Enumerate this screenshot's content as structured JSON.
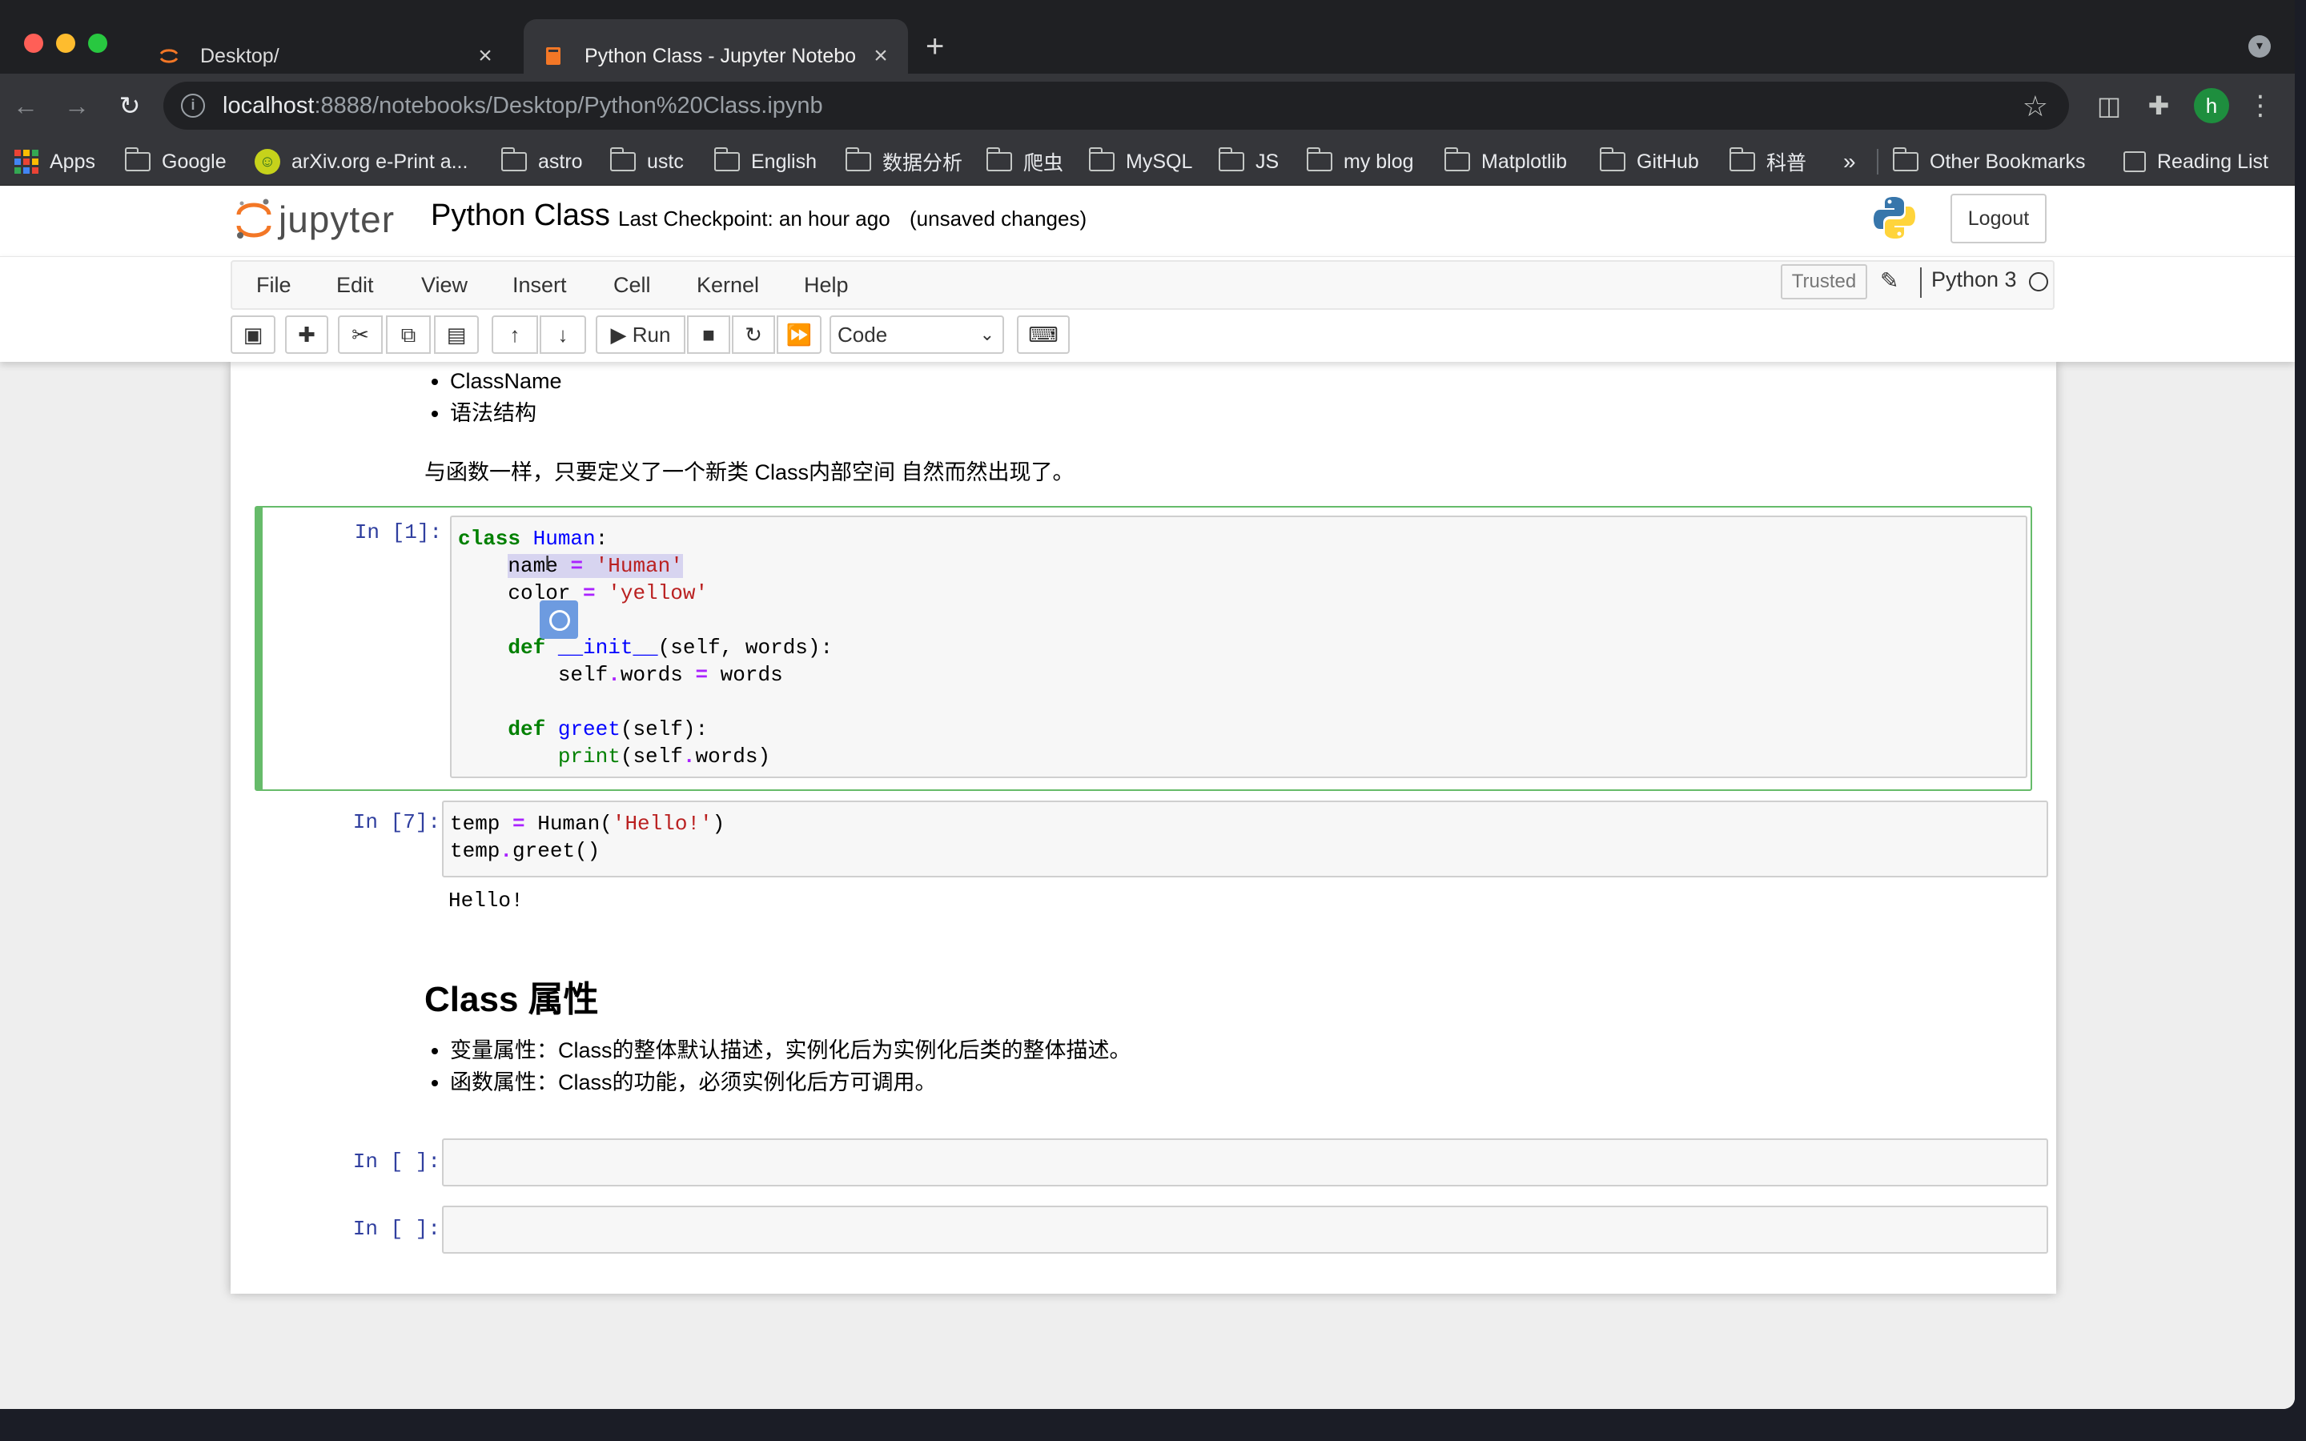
{
  "browser": {
    "tabs": [
      {
        "title": "Desktop/",
        "active": false
      },
      {
        "title": "Python Class - Jupyter Notebo",
        "active": true
      }
    ],
    "new_tab": "+",
    "address": {
      "host": "localhost",
      "path": ":8888/notebooks/Desktop/Python%20Class.ipynb"
    },
    "bookmarks": [
      {
        "label": "Apps",
        "icon": "apps-grid-icon"
      },
      {
        "label": "Google",
        "icon": "folder-icon"
      },
      {
        "label": "arXiv.org e-Print a...",
        "icon": "arxiv-icon"
      },
      {
        "label": "astro",
        "icon": "folder-icon"
      },
      {
        "label": "ustc",
        "icon": "folder-icon"
      },
      {
        "label": "English",
        "icon": "folder-icon"
      },
      {
        "label": "数据分析",
        "icon": "folder-icon"
      },
      {
        "label": "爬虫",
        "icon": "folder-icon"
      },
      {
        "label": "MySQL",
        "icon": "folder-icon"
      },
      {
        "label": "JS",
        "icon": "folder-icon"
      },
      {
        "label": "my blog",
        "icon": "folder-icon"
      },
      {
        "label": "Matplotlib",
        "icon": "folder-icon"
      },
      {
        "label": "GitHub",
        "icon": "folder-icon"
      },
      {
        "label": "科普",
        "icon": "folder-icon"
      }
    ],
    "bookmarks_more": "»",
    "other_bookmarks": "Other Bookmarks",
    "reading_list": "Reading List",
    "profile_initial": "h"
  },
  "jupyter": {
    "logo_text": "jupyter",
    "notebook_title": "Python Class",
    "checkpoint": "Last Checkpoint: an hour ago",
    "unsaved": "(unsaved changes)",
    "logout": "Logout",
    "menu": [
      "File",
      "Edit",
      "View",
      "Insert",
      "Cell",
      "Kernel",
      "Help"
    ],
    "trusted": "Trusted",
    "kernel": "Python 3",
    "run_label": "Run",
    "cell_type": "Code",
    "colors": {
      "brand_orange": "#f37726",
      "prompt_blue": "#303f9f",
      "selected_green": "#66bb6a"
    }
  },
  "notebook": {
    "top_list": [
      "ClassName",
      "语法结构"
    ],
    "para1": "与函数一样，只要定义了一个新类 Class内部空间 自然而然出现了。",
    "cell1": {
      "prompt": "In [1]:"
    },
    "cell2": {
      "prompt": "In [7]:",
      "output": "Hello!"
    },
    "heading": "Class 属性",
    "attr_list": [
      "变量属性：Class的整体默认描述，实例化后为实例化后类的整体描述。",
      "函数属性：Class的功能，必须实例化后方可调用。"
    ],
    "cell3": {
      "prompt": "In [ ]:"
    },
    "cell4": {
      "prompt": "In [ ]:"
    }
  }
}
